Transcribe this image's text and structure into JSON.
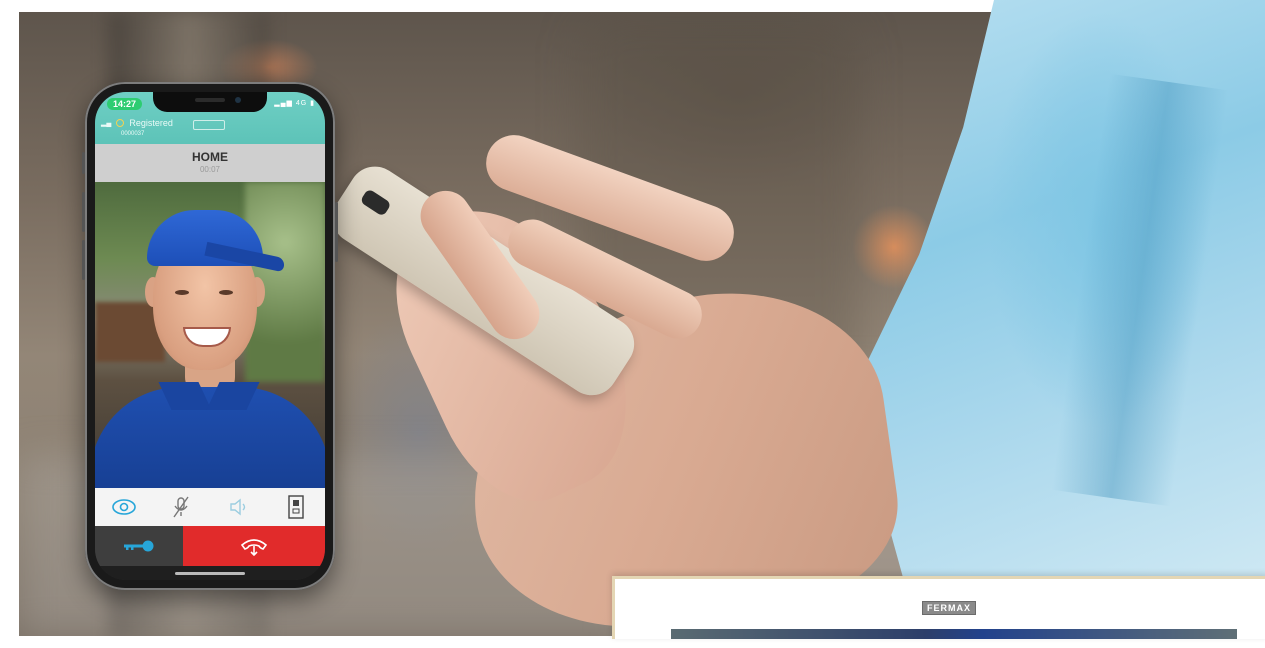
{
  "phone": {
    "status_time": "14:27",
    "system_icons": "▂▄▆ 4G ▮",
    "registration_status": "Registered",
    "sip_number": "0000037",
    "contact_name": "HOME",
    "call_timer": "00:07",
    "controls": [
      "eye-icon",
      "mic-muted-icon",
      "speaker-icon",
      "door-panel-icon"
    ],
    "actions": [
      "key-icon",
      "hang-up-icon"
    ],
    "colors": {
      "header": "#5dc3b8",
      "hangup": "#e12b2b",
      "key_bg": "#3e3e3e",
      "key_icon": "#27a6d9"
    }
  },
  "monitor": {
    "brand": "FERMAX"
  }
}
